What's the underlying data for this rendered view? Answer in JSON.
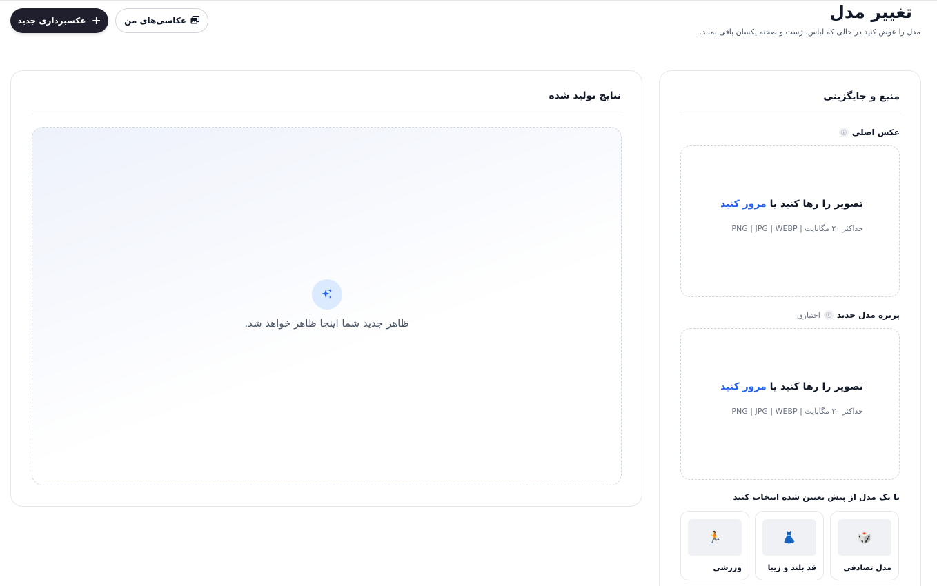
{
  "header": {
    "title": "تغییر مدل",
    "subtitle": "مدل را عوض کنید در حالی که لباس، ژست و صحنه یکسان باقی بماند."
  },
  "actions": {
    "new_photo_label": "عکسبرداری جدید",
    "new_photo_icon": "plus-icon",
    "my_photos_label": "عکاسی‌های من",
    "my_photos_icon": "gallery-icon"
  },
  "results": {
    "title": "نتایج تولید شده",
    "empty_text": "ظاهر جدید شما اینجا ظاهر خواهد شد.",
    "icon": "sparkle-icon",
    "accent": "#2563eb"
  },
  "source": {
    "title": "منبع و جایگزینی",
    "original": {
      "label": "عکس اصلی",
      "drop_text": "تصویر را رها کنید یا",
      "browse_text": "مرور کنید",
      "hint": "حداکثر ۲۰ مگابایت | PNG | JPG | WEBP"
    },
    "new_model": {
      "label": "پرتره مدل جدید",
      "optional": "اختیاری",
      "drop_text": "تصویر را رها کنید یا",
      "browse_text": "مرور کنید",
      "hint": "حداکثر ۲۰ مگابایت | PNG | JPG | WEBP"
    },
    "presets_title": "یا یک مدل از پیش تعیین شده انتخاب کنید",
    "presets": [
      {
        "label": "مدل تصادفی",
        "icon": "dice-icon",
        "glyph": "🎲"
      },
      {
        "label": "قد بلند و زیبا",
        "icon": "dress-icon",
        "glyph": "👗"
      },
      {
        "label": "ورزشی",
        "icon": "runner-icon",
        "glyph": "🏃"
      }
    ]
  }
}
